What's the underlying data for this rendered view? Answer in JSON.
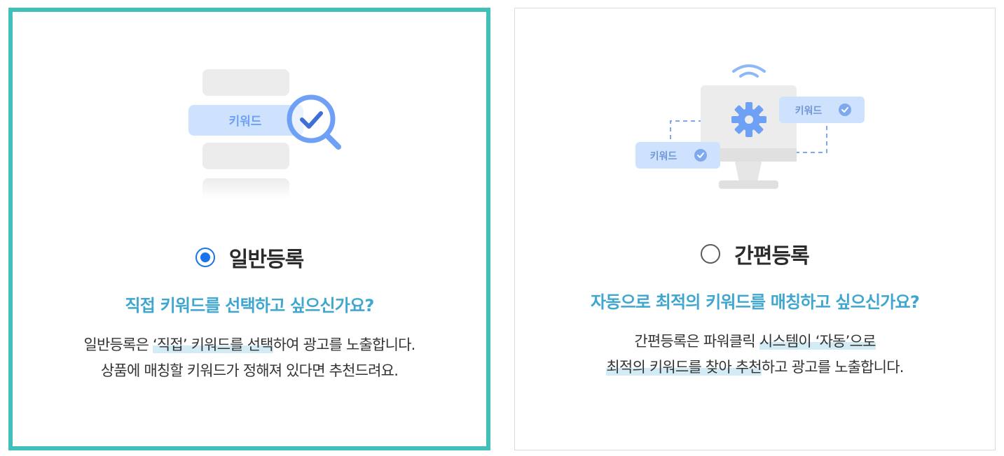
{
  "options": [
    {
      "id": "general",
      "title": "일반등록",
      "selected": true,
      "question": "직접 키워드를 선택하고 싶으신가요?",
      "desc_line1_pre": "일반등록은 ",
      "desc_line1_hl": "‘직접’ 키워드를 선택",
      "desc_line1_post": "하여 광고를 노출합니다.",
      "desc_line2": "상품에 매칭할 키워드가 정해져 있다면 추천드려요.",
      "illust_label": "키워드"
    },
    {
      "id": "simple",
      "title": "간편등록",
      "selected": false,
      "question": "자동으로 최적의 키워드를 매칭하고 싶으신가요?",
      "desc_line1_pre": "간편등록은 파워클릭 ",
      "desc_line1_hl": "시스템이 ‘자동’으로",
      "desc_line2_hl": "최적의 키워드를 찾아 추천",
      "desc_line2_post": "하고 광고를 노출합니다.",
      "illust_label_right": "키워드",
      "illust_label_left": "키워드"
    }
  ],
  "colors": {
    "selected_border": "#41c0b9",
    "radio_checked": "#1a73e8",
    "question_text": "#3fa7cf",
    "highlight": "#d3ebf4",
    "illust_blue": "#6ea1f5",
    "illust_light_blue": "#cfe2fd"
  },
  "icons": [
    "magnifier-check-icon",
    "monitor-gear-icon",
    "wifi-icon",
    "check-circle-icon"
  ]
}
